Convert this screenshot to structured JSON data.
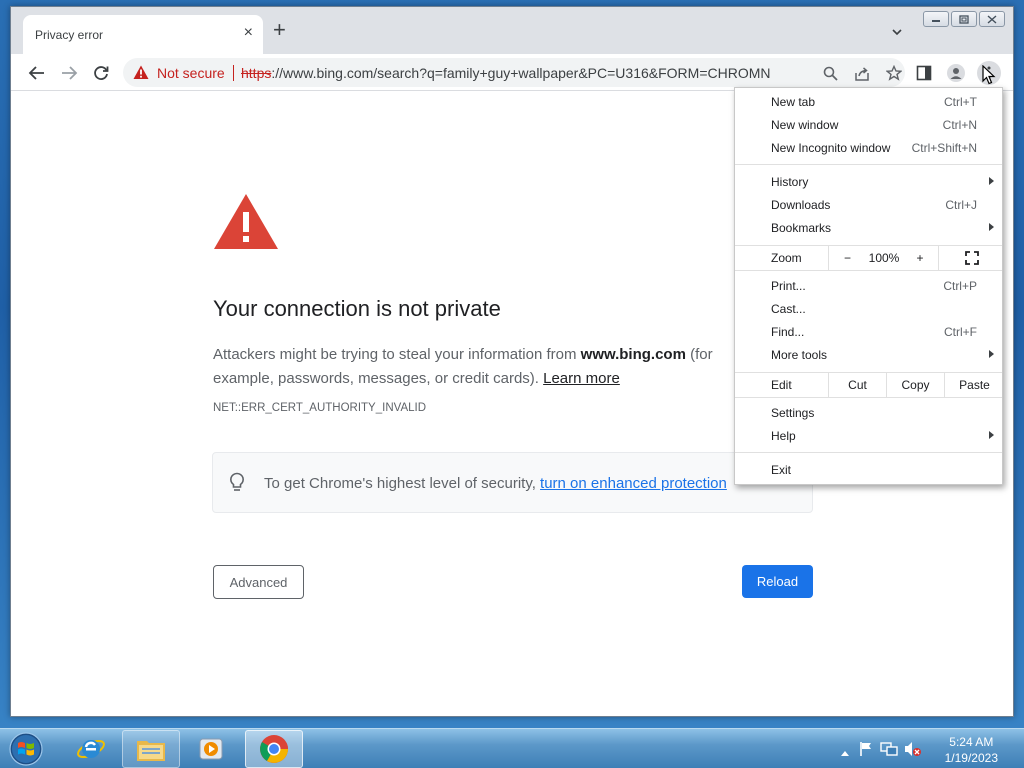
{
  "browser": {
    "tab": {
      "title": "Privacy error",
      "close": "×"
    },
    "new_tab": "+",
    "window_controls": [
      "minimize",
      "restore",
      "close"
    ],
    "omnibox": {
      "security_label": "Not secure",
      "url_scheme": "https",
      "url_rest": "://www.bing.com/search?q=family+guy+wallpaper&PC=U316&FORM=CHROMN"
    }
  },
  "error_page": {
    "title": "Your connection is not private",
    "desc_before": "Attackers might be trying to steal your information from ",
    "desc_host": "www.bing.com",
    "desc_after": " (for example, passwords, messages, or credit cards). ",
    "learn_more": "Learn more",
    "error_code": "NET::ERR_CERT_AUTHORITY_INVALID",
    "enhanced_text": "To get Chrome's highest level of security, ",
    "enhanced_link": "turn on enhanced protection",
    "advanced_button": "Advanced",
    "reload_button": "Reload"
  },
  "menu": {
    "new_tab": {
      "label": "New tab",
      "shortcut": "Ctrl+T"
    },
    "new_window": {
      "label": "New window",
      "shortcut": "Ctrl+N"
    },
    "incognito": {
      "label": "New Incognito window",
      "shortcut": "Ctrl+Shift+N"
    },
    "history": {
      "label": "History"
    },
    "downloads": {
      "label": "Downloads",
      "shortcut": "Ctrl+J"
    },
    "bookmarks": {
      "label": "Bookmarks"
    },
    "zoom": {
      "label": "Zoom",
      "minus": "−",
      "value": "100%",
      "plus": "+"
    },
    "print": {
      "label": "Print...",
      "shortcut": "Ctrl+P"
    },
    "cast": {
      "label": "Cast..."
    },
    "find": {
      "label": "Find...",
      "shortcut": "Ctrl+F"
    },
    "more_tools": {
      "label": "More tools"
    },
    "edit": {
      "label": "Edit",
      "cut": "Cut",
      "copy": "Copy",
      "paste": "Paste"
    },
    "settings": {
      "label": "Settings"
    },
    "help": {
      "label": "Help"
    },
    "exit": {
      "label": "Exit"
    }
  },
  "taskbar": {
    "time": "5:24 AM",
    "date": "1/19/2023",
    "apps": [
      "internet-explorer",
      "file-explorer",
      "media-player",
      "chrome"
    ]
  },
  "colors": {
    "danger": "#c5221f",
    "warning_red": "#db4437",
    "link_blue": "#1a73e8"
  }
}
